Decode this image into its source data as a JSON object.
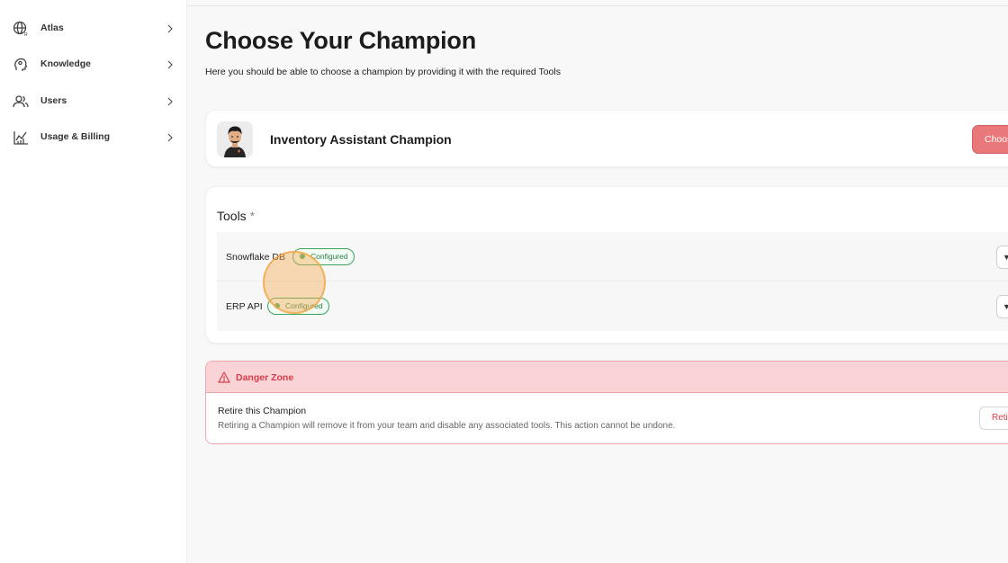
{
  "sidebar": {
    "items": [
      {
        "label": "Atlas",
        "icon": "globe-icon"
      },
      {
        "label": "Knowledge",
        "icon": "brain-head-icon"
      },
      {
        "label": "Users",
        "icon": "users-icon"
      },
      {
        "label": "Usage & Billing",
        "icon": "usage-chart-icon"
      }
    ]
  },
  "header": {
    "title": "Choose Your Champion",
    "subtitle": "Here you should be able to choose a champion by providing it with the required Tools"
  },
  "champion": {
    "name": "Inventory Assistant Champion",
    "choose_label": "Choos"
  },
  "tools": {
    "title": "Tools",
    "required_marker": "*",
    "items": [
      {
        "name": "Snowflake DB",
        "status": "Configured"
      },
      {
        "name": "ERP API",
        "status": "Configured"
      }
    ]
  },
  "danger_zone": {
    "title": "Danger Zone",
    "retire_title": "Retire this Champion",
    "retire_description": "Retiring a Champion will remove it from your team and disable any associated tools. This action cannot be undone.",
    "retire_button": "Reti"
  },
  "colors": {
    "danger": "#d83c48",
    "danger_bg": "#fad3d6",
    "choose_button": "#e8787a",
    "configured": "#3aa45b"
  }
}
